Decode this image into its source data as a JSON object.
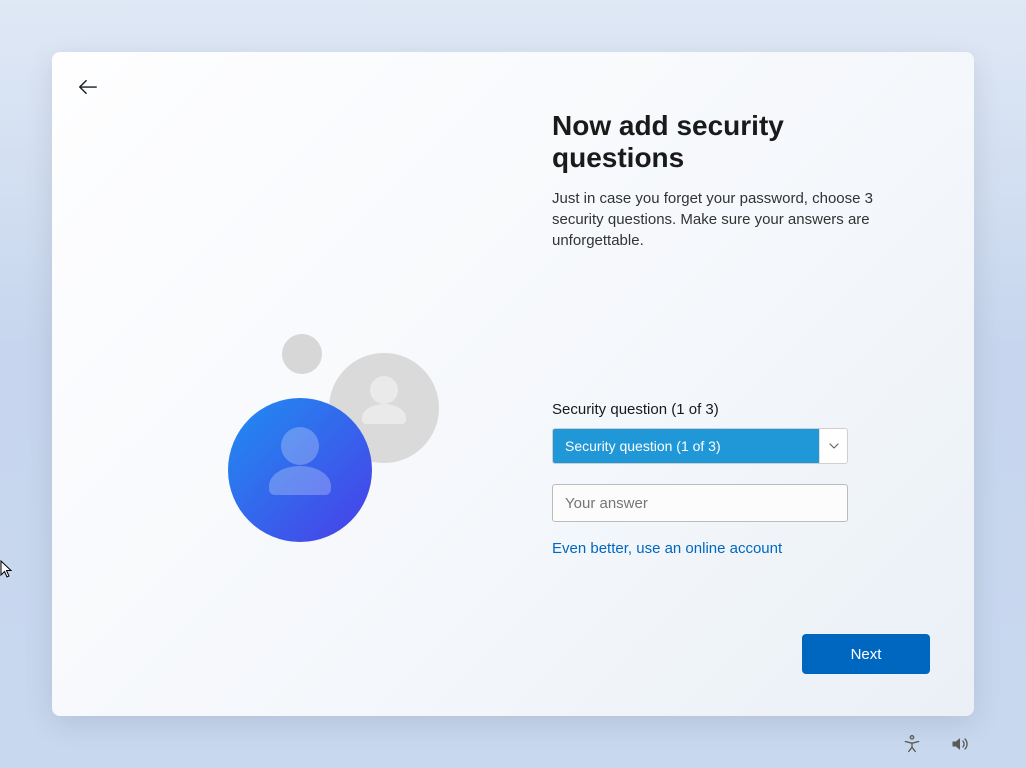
{
  "header": {
    "title": "Now add security questions",
    "subtitle": "Just in case you forget your password, choose 3 security questions. Make sure your answers are unforgettable."
  },
  "form": {
    "question_label": "Security question (1 of 3)",
    "question_selected": "Security question (1 of 3)",
    "answer_placeholder": "Your answer",
    "online_account_link": "Even better, use an online account"
  },
  "actions": {
    "next_label": "Next"
  },
  "colors": {
    "accent": "#0067c0",
    "dropdown_highlight": "#2097d6"
  }
}
